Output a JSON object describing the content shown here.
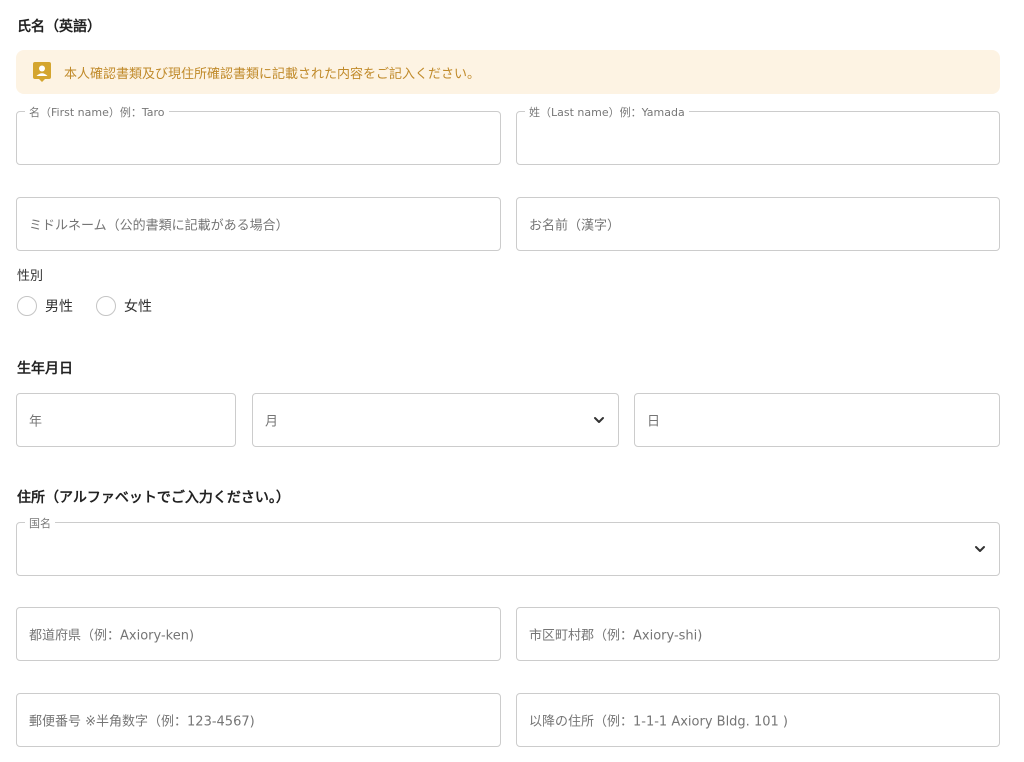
{
  "name_section": {
    "title": "氏名（英語）",
    "notice": "本人確認書類及び現住所確認書類に記載された内容をご記入ください。",
    "first_name_label": "名（First name）例：Taro",
    "last_name_label": "姓（Last name）例：Yamada",
    "middle_name_placeholder": "ミドルネーム（公的書類に記載がある場合）",
    "kanji_name_placeholder": "お名前（漢字）"
  },
  "gender": {
    "label": "性別",
    "options": [
      "男性",
      "女性"
    ]
  },
  "birthdate": {
    "title": "生年月日",
    "year_placeholder": "年",
    "month_placeholder": "月",
    "day_placeholder": "日"
  },
  "address": {
    "title": "住所（アルファベットでご入力ください。）",
    "country_label": "国名",
    "prefecture_placeholder": "都道府県（例：Axiory-ken)",
    "city_placeholder": "市区町村郡（例：Axiory-shi)",
    "postal_placeholder": "郵便番号 ※半角数字（例：123-4567)",
    "street_placeholder": "以降の住所（例：1-1-1 Axiory Bldg. 101 )"
  },
  "colors": {
    "notice_bg": "#fdf3e3",
    "notice_text": "#c08a2a",
    "notice_icon": "#d4a52f",
    "border": "#cccccc"
  },
  "icons": {
    "notice": "person-card-icon",
    "dropdown": "chevron-down-icon"
  }
}
